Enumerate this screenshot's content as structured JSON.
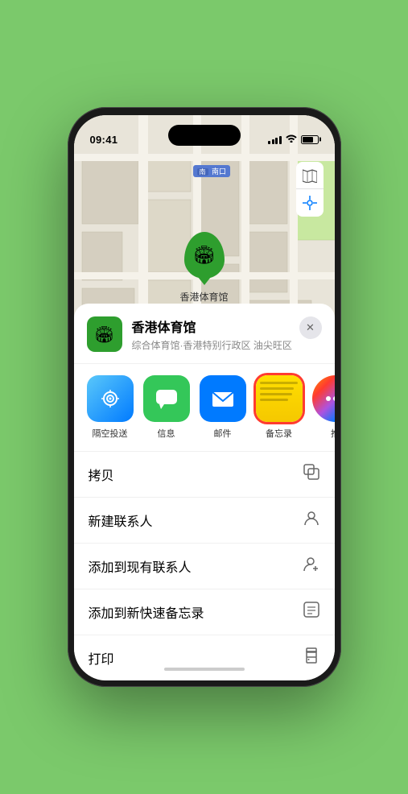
{
  "status": {
    "time": "09:41",
    "location_arrow": "▶"
  },
  "map": {
    "south_label": "南口",
    "south_label_prefix": "南口",
    "map_style_label": "🗺",
    "location_btn": "◎",
    "marker": {
      "icon": "🏟",
      "name": "香港体育馆"
    }
  },
  "venue_card": {
    "name": "香港体育馆",
    "address": "综合体育馆·香港特别行政区 油尖旺区",
    "close_label": "✕"
  },
  "share_apps": [
    {
      "id": "airdrop",
      "label": "隔空投送",
      "icon": "📡"
    },
    {
      "id": "messages",
      "label": "信息",
      "icon": "💬"
    },
    {
      "id": "mail",
      "label": "邮件",
      "icon": "✉"
    },
    {
      "id": "notes",
      "label": "备忘录",
      "icon": "notes"
    },
    {
      "id": "more",
      "label": "推",
      "icon": "•••"
    }
  ],
  "actions": [
    {
      "id": "copy",
      "label": "拷贝",
      "icon": "⧉"
    },
    {
      "id": "new-contact",
      "label": "新建联系人",
      "icon": "👤"
    },
    {
      "id": "add-existing",
      "label": "添加到现有联系人",
      "icon": "👤+"
    },
    {
      "id": "quick-note",
      "label": "添加到新快速备忘录",
      "icon": "⬜"
    },
    {
      "id": "print",
      "label": "打印",
      "icon": "🖨"
    }
  ]
}
